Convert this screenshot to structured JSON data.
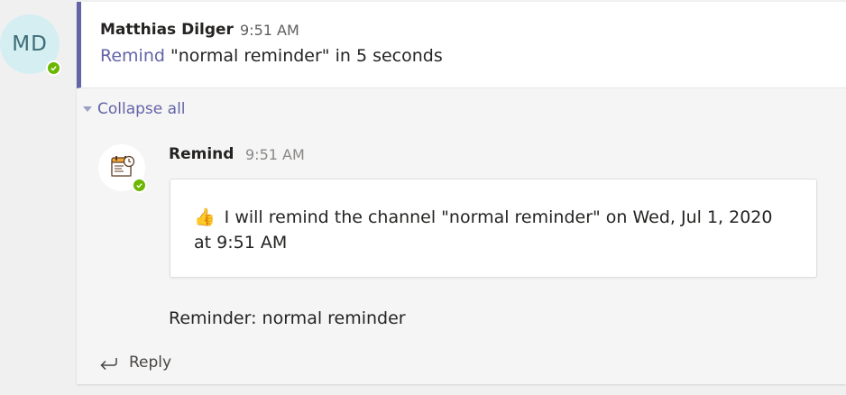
{
  "user": {
    "initials": "MD",
    "presence": "available"
  },
  "parent_message": {
    "author": "Matthias Dilger",
    "time": "9:51 AM",
    "mention": "Remind",
    "text": " \"normal reminder\" in 5 seconds"
  },
  "collapse_label": "Collapse all",
  "bot_reply": {
    "name": "Remind",
    "time": "9:51 AM",
    "card_emoji": "👍",
    "card_text": "I will remind the channel \"normal reminder\" on Wed, Jul 1, 2020 at 9:51 AM",
    "reminder_text": "Reminder: normal reminder"
  },
  "reply_label": "Reply",
  "colors": {
    "accent": "#6264a7",
    "presence": "#6bb700",
    "avatar_bg": "#d4eef2"
  },
  "icons": [
    "checkmark-icon",
    "calendar-bot-icon",
    "reply-arrow-icon",
    "chevron-down-icon"
  ]
}
